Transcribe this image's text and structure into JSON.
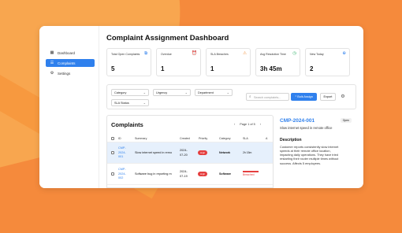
{
  "sidebar": {
    "items": [
      {
        "label": "Dashboard",
        "icon": "chart-icon"
      },
      {
        "label": "Complaints",
        "icon": "list-icon",
        "active": true
      },
      {
        "label": "Settings",
        "icon": "gear-icon"
      }
    ]
  },
  "header": {
    "title": "Complaint Assignment Dashboard"
  },
  "kpis": [
    {
      "label": "Total Open Complaints",
      "value": "5",
      "icon": "folder-icon",
      "color": "#2f80ed"
    },
    {
      "label": "Overdue",
      "value": "1",
      "icon": "alarm-icon",
      "color": "#e53e3e"
    },
    {
      "label": "SLA Breaches",
      "value": "1",
      "icon": "warning-icon",
      "color": "#f2994a"
    },
    {
      "label": "Avg Resolution Time",
      "value": "3h 45m",
      "icon": "clock-icon",
      "color": "#27ae60"
    },
    {
      "label": "New Today",
      "value": "2",
      "icon": "plus-circle-icon",
      "color": "#2f80ed"
    }
  ],
  "filters": {
    "category": "Category",
    "urgency": "Urgency",
    "department": "Department",
    "sla_status": "SLA Status",
    "search_placeholder": "Search complaints...",
    "bulk_assign": "Bulk Assign",
    "export": "Export"
  },
  "complaints": {
    "title": "Complaints",
    "page": "Page 1 of 5",
    "columns": [
      "ID",
      "Summary",
      "Created",
      "Priority",
      "Category",
      "SLA",
      "A"
    ],
    "rows": [
      {
        "id_lines": [
          "CMP-",
          "2024-",
          "001"
        ],
        "summary": "Slow internet speed in remo",
        "created_lines": [
          "2024-",
          "07-20"
        ],
        "priority": "High",
        "category": "Network",
        "sla": "2h 15m",
        "sla_bar": false
      },
      {
        "id_lines": [
          "CMP-",
          "2024-",
          "002"
        ],
        "summary": "Software bug in reporting m",
        "created_lines": [
          "2024-",
          "07-19"
        ],
        "priority": "High",
        "category": "Software",
        "sla": "Breached",
        "sla_bar": true
      }
    ]
  },
  "detail": {
    "id": "CMP-2024-001",
    "status": "Open",
    "summary": "Slow internet speed in remote office",
    "section": "Description",
    "description": "Customer reports consistently slow internet speeds at their remote office location, impacting daily operations. They have tried restarting their router multiple times without success. Affects 5 employees."
  }
}
